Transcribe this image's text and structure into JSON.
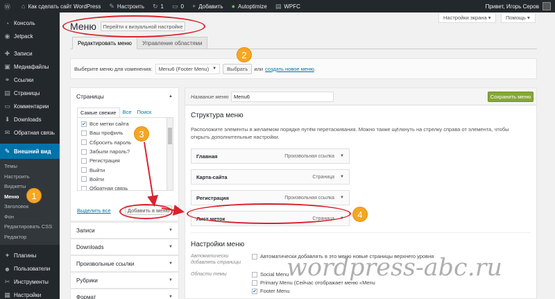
{
  "adminbar": {
    "site_name": "Как сделать сайт WordPress",
    "customize": "Настроить",
    "updates_count": "1",
    "comments_count": "0",
    "add_new": "Добавить",
    "autoptimize": "Autoptimize",
    "wpfc": "WPFC",
    "greeting": "Привет, Игорь Серов"
  },
  "sidebar": {
    "items_top": [
      {
        "label": "Консоль",
        "icon": "dashboard-icon"
      },
      {
        "label": "Jetpack",
        "icon": "jetpack-icon"
      }
    ],
    "items_mid": [
      {
        "label": "Записи",
        "icon": "pin-icon"
      },
      {
        "label": "Медиафайлы",
        "icon": "media-icon"
      },
      {
        "label": "Ссылки",
        "icon": "link-icon"
      },
      {
        "label": "Страницы",
        "icon": "page-icon"
      },
      {
        "label": "Комментарии",
        "icon": "comment-icon"
      },
      {
        "label": "Downloads",
        "icon": "download-icon"
      },
      {
        "label": "Обратная связь",
        "icon": "feedback-icon"
      }
    ],
    "current": {
      "label": "Внешний вид",
      "icon": "appearance-icon"
    },
    "submenu": [
      "Темы",
      "Настроить",
      "Виджеты",
      "Меню",
      "Заголовок",
      "Фон",
      "Редактировать CSS",
      "Редактор"
    ],
    "submenu_active": "Меню",
    "items_bottom": [
      {
        "label": "Плагины",
        "icon": "plugin-icon"
      },
      {
        "label": "Пользователи",
        "icon": "users-icon"
      },
      {
        "label": "Инструменты",
        "icon": "tools-icon"
      },
      {
        "label": "Настройки",
        "icon": "settings-icon"
      }
    ]
  },
  "header": {
    "screen_options": "Настройки экрана ▾",
    "help": "Помощь ▾",
    "title": "Меню",
    "visual_button": "Перейти к визуальной настройке"
  },
  "tabs": {
    "edit": "Редактировать меню",
    "locations": "Управление областями"
  },
  "select_bar": {
    "label": "Выберите меню для изменения:",
    "selected": "Menu6 (Footer Menu)",
    "select_button": "Выбрать",
    "or": "или",
    "create_link": "создать новое меню",
    "dot": "."
  },
  "pages_panel": {
    "title": "Страницы",
    "tabs": [
      "Самые свежие",
      "Все",
      "Поиск"
    ],
    "items": [
      {
        "label": "Все метки сайта",
        "checked": true
      },
      {
        "label": "Ваш профиль",
        "checked": false
      },
      {
        "label": "Сбросить пароль",
        "checked": false
      },
      {
        "label": "Забыли пароль?",
        "checked": false
      },
      {
        "label": "Регистрация",
        "checked": false
      },
      {
        "label": "Выйти",
        "checked": false
      },
      {
        "label": "Войти",
        "checked": false
      },
      {
        "label": "Обратная связь",
        "checked": false
      }
    ],
    "select_all": "Выделить все",
    "add_button": "Добавить в меню"
  },
  "collapsed_panels": [
    "Записи",
    "Downloads",
    "Произвольные ссылки",
    "Рубрики",
    "Формат"
  ],
  "structure": {
    "name_label": "Название меню",
    "name_value": "Menu6",
    "save_button": "Сохранить меню",
    "heading": "Структура меню",
    "hint": "Расположите элементы в желаемом порядке путём перетаскивания. Можно также щёлкнуть на стрелку справа от элемента, чтобы открыть дополнительные настройки.",
    "items": [
      {
        "title": "Главная",
        "type": "Произвольная ссылка"
      },
      {
        "title": "Карта-сайта",
        "type": "Страница"
      },
      {
        "title": "Регистрация",
        "type": "Произвольная ссылка"
      },
      {
        "title": "Лист меток",
        "type": "Страница"
      }
    ]
  },
  "settings": {
    "heading": "Настройки меню",
    "auto_add_label": "Автоматически добавлять страницы",
    "auto_add_text": "Автоматически добавлять в это меню новые страницы верхнего уровня",
    "areas_label": "Области темы",
    "areas": [
      {
        "label": "Social Menu",
        "checked": false
      },
      {
        "label": "Primary Menu (Сейчас отображает меню «Menu",
        "checked": false
      },
      {
        "label": "Footer Menu",
        "checked": true
      }
    ]
  },
  "annotations": [
    "1",
    "2",
    "3",
    "4"
  ],
  "watermark": "wordpress-abc.ru"
}
